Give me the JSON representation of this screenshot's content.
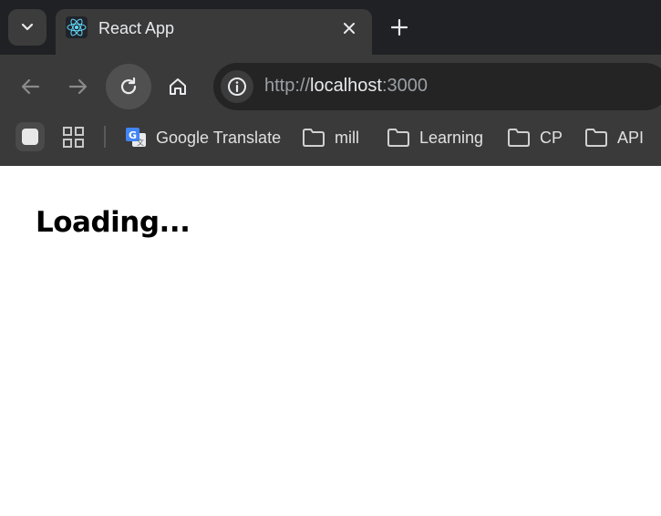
{
  "browser": {
    "tab": {
      "title": "React App",
      "favicon": "react-logo-icon"
    },
    "address_bar": {
      "scheme": "http://",
      "host": "localhost",
      "port": ":3000"
    },
    "bookmarks": [
      {
        "label": "Google Translate",
        "icon": "google-translate-icon"
      },
      {
        "label": "mill",
        "icon": "folder-icon"
      },
      {
        "label": "Learning",
        "icon": "folder-icon"
      },
      {
        "label": "CP",
        "icon": "folder-icon"
      },
      {
        "label": "API",
        "icon": "folder-icon"
      }
    ]
  },
  "page": {
    "heading": "Loading..."
  },
  "colors": {
    "tabstrip": "#202124",
    "toolbar": "#3a3a3a",
    "omnibox": "#242424",
    "react_accent": "#61dafb"
  }
}
